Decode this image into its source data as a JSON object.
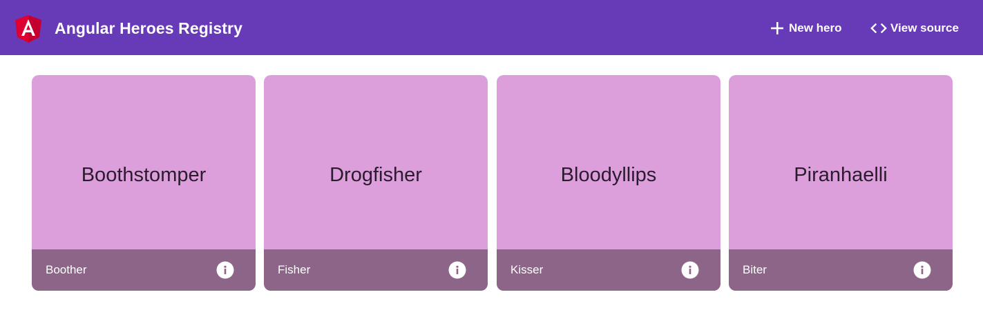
{
  "toolbar": {
    "title": "Angular Heroes Registry",
    "new_hero_label": "New hero",
    "view_source_label": "View source",
    "background_color": "#673ab7",
    "logo_icon": "angular-logo-icon"
  },
  "heroes": [
    {
      "name": "Boothstomper",
      "power": "Boother"
    },
    {
      "name": "Drogfisher",
      "power": "Fisher"
    },
    {
      "name": "Bloodyllips",
      "power": "Kisser"
    },
    {
      "name": "Piranhaelli",
      "power": "Biter"
    }
  ],
  "colors": {
    "card_body": "#dd9fdb",
    "card_footer": "#8d6589"
  }
}
